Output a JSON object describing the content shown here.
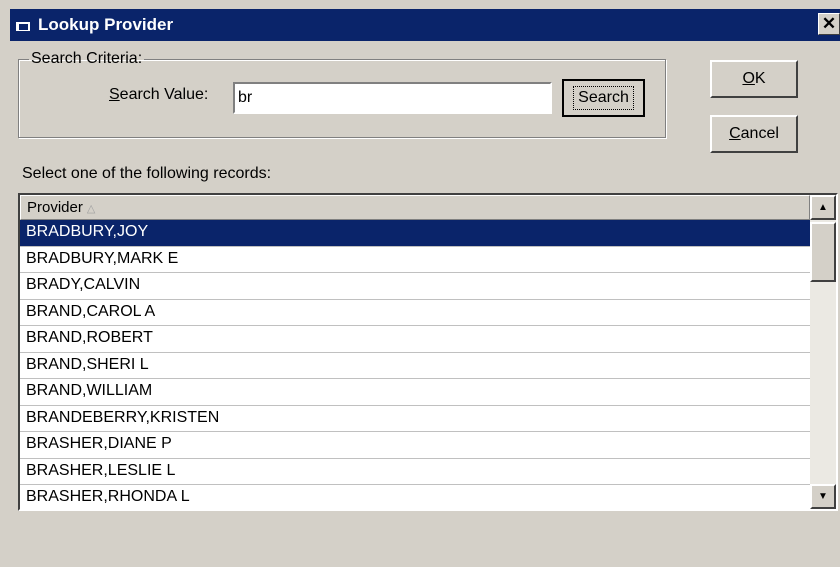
{
  "window": {
    "title": "Lookup Provider",
    "close_glyph": "✕"
  },
  "criteria": {
    "legend": "Search Criteria:",
    "search_label_prefix": "S",
    "search_label_rest": "earch Value:",
    "search_value": "br",
    "search_button": "Search"
  },
  "buttons": {
    "ok_prefix": "O",
    "ok_rest": "K",
    "cancel_prefix": "C",
    "cancel_rest": "ancel"
  },
  "list": {
    "instruction": "Select one of the following records:",
    "column_header": "Provider",
    "sort_icon": "sort-ascending-icon",
    "rows": [
      "BRADBURY,JOY",
      "BRADBURY,MARK E",
      "BRADY,CALVIN",
      "BRAND,CAROL A",
      "BRAND,ROBERT",
      "BRAND,SHERI L",
      "BRAND,WILLIAM",
      "BRANDEBERRY,KRISTEN",
      "BRASHER,DIANE P",
      "BRASHER,LESLIE L",
      "BRASHER,RHONDA L"
    ],
    "selected_index": 0
  },
  "colors": {
    "title_bar": "#0a246a",
    "selection": "#0a246a",
    "face": "#d4d0c8"
  }
}
